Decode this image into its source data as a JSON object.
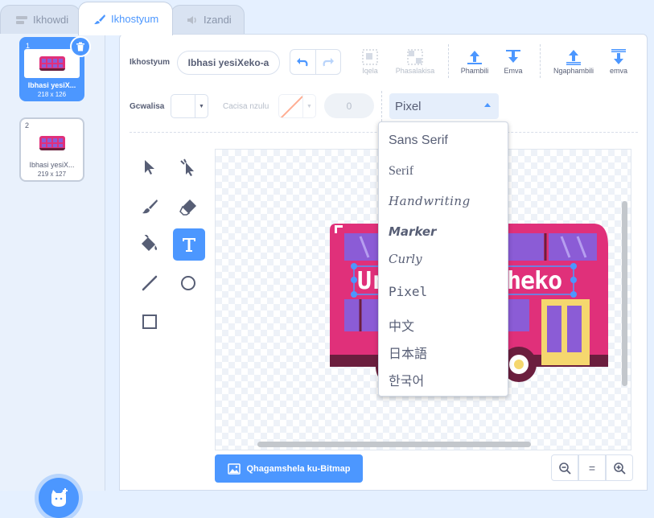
{
  "tabs": [
    {
      "label": "Ikhowdi",
      "icon": "code-icon"
    },
    {
      "label": "Ikhostyum",
      "icon": "paintbrush-icon"
    },
    {
      "label": "Izandi",
      "icon": "speaker-icon"
    }
  ],
  "costumes": [
    {
      "number": "1",
      "name": "Ibhasi yesiX...",
      "size": "218 x 126"
    },
    {
      "number": "2",
      "name": "Ibhasi yesiX...",
      "size": "219 x 127"
    }
  ],
  "toolbar": {
    "costume_label": "Ikhostyum",
    "costume_name": "Ibhasi yesiXeko-a",
    "group": "Iqela",
    "ungroup": "Phasalakisa",
    "forward": "Phambili",
    "backward": "Emva",
    "front": "Ngaphambili",
    "back": "emva",
    "fill_label": "Gcwalisa",
    "outline_label": "Cacisa nzulu",
    "outline_width": "0",
    "font": "Pixel"
  },
  "font_options": [
    "Sans Serif",
    "Serif",
    "Handwriting",
    "Marker",
    "Curly",
    "Pixel",
    "中文",
    "日本語",
    "한국어"
  ],
  "canvas": {
    "bus_text_left": "Un",
    "bus_text_right": "heko"
  },
  "convert_button": "Qhagamshela ku-Bitmap",
  "zoom": {
    "out": "−",
    "reset": "=",
    "in": "+"
  },
  "colors": {
    "accent": "#4c97ff",
    "bus_body": "#e0307a",
    "bus_window": "#8b5cd6",
    "bus_dark": "#6b1e3e",
    "door": "#f5d76e"
  }
}
